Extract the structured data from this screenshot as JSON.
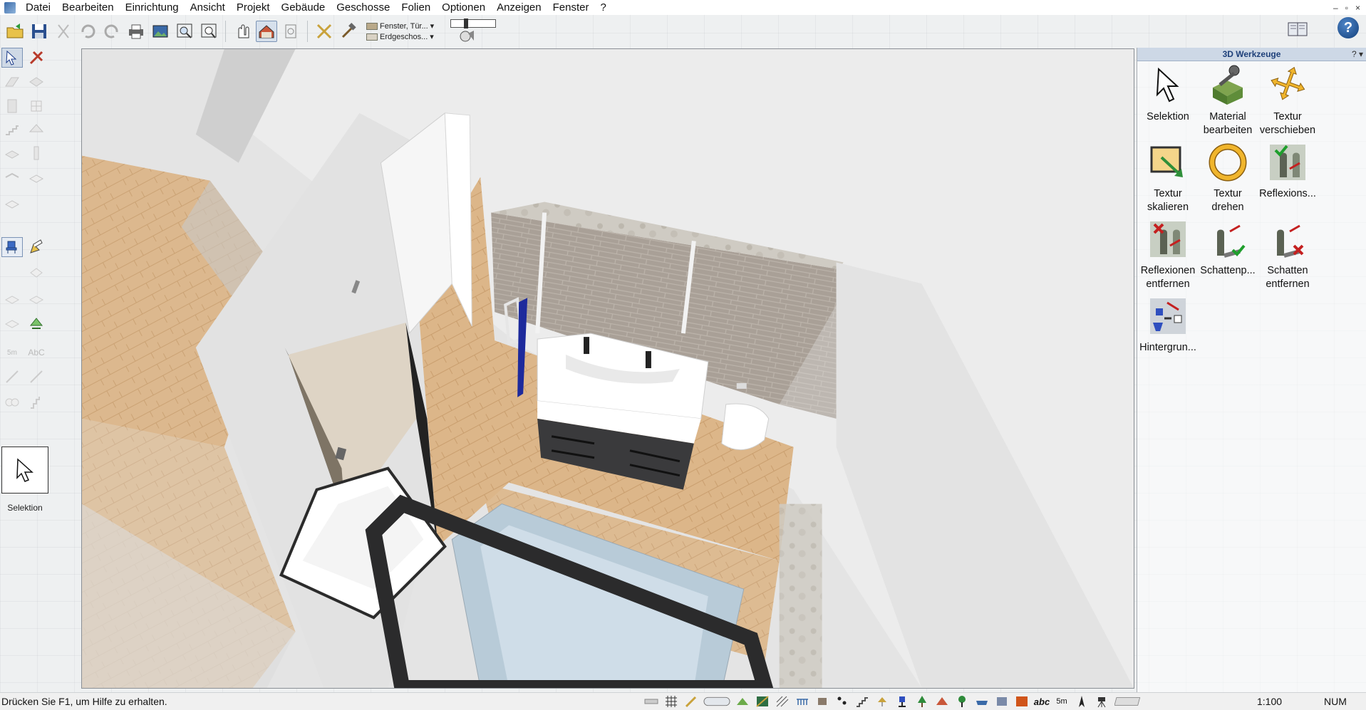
{
  "menu": {
    "items": [
      "Datei",
      "Bearbeiten",
      "Einrichtung",
      "Ansicht",
      "Projekt",
      "Gebäude",
      "Geschosse",
      "Folien",
      "Optionen",
      "Anzeigen",
      "Fenster",
      "?"
    ],
    "window_controls": [
      "–",
      "▫",
      "×"
    ]
  },
  "toolbar": {
    "combo_1": "Fenster, Tür...",
    "combo_2": "Erdgeschos...",
    "help_label": "?"
  },
  "left_panel": {
    "current_tool_label": "Selektion"
  },
  "right_panel": {
    "title": "3D Werkzeuge",
    "title_controls": "? ▾",
    "tools": [
      {
        "label": "Selektion",
        "icon": "cursor-arrow-icon"
      },
      {
        "label": "Material bearbeiten",
        "icon": "material-edit-icon"
      },
      {
        "label": "Textur verschieben",
        "icon": "texture-move-icon"
      },
      {
        "label": "Textur skalieren",
        "icon": "texture-scale-icon"
      },
      {
        "label": "Textur drehen",
        "icon": "texture-rotate-icon"
      },
      {
        "label": "Reflexions...",
        "icon": "reflection-icon"
      },
      {
        "label": "Reflexionen entfernen",
        "icon": "reflection-remove-icon"
      },
      {
        "label": "Schattenp...",
        "icon": "shadow-icon"
      },
      {
        "label": "Schatten entfernen",
        "icon": "shadow-remove-icon"
      },
      {
        "label": "Hintergrun...",
        "icon": "background-icon"
      }
    ]
  },
  "status": {
    "hint": "Drücken Sie F1, um Hilfe zu erhalten.",
    "scale": "1:100",
    "num": "NUM",
    "abc": "abc",
    "dim": "5m"
  },
  "colors": {
    "accent": "#1d3f79",
    "floor_wood": "#d9b487",
    "wall": "#ececec",
    "brick": "#a79d93",
    "towel_blue": "#1d2a9c"
  }
}
